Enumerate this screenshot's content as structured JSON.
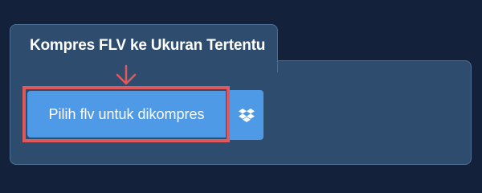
{
  "panel": {
    "title": "Kompres FLV ke Ukuran Tertentu",
    "upload_button_label": "Pilih flv untuk dikompres",
    "dropbox_icon": "dropbox-icon",
    "arrow_icon": "down-arrow-icon"
  },
  "colors": {
    "page_background": "#13213a",
    "panel_background": "#2e4d6e",
    "panel_border": "#4e6f94",
    "button": "#4f9ae6",
    "highlight": "#e0585b",
    "text": "#ffffff"
  }
}
